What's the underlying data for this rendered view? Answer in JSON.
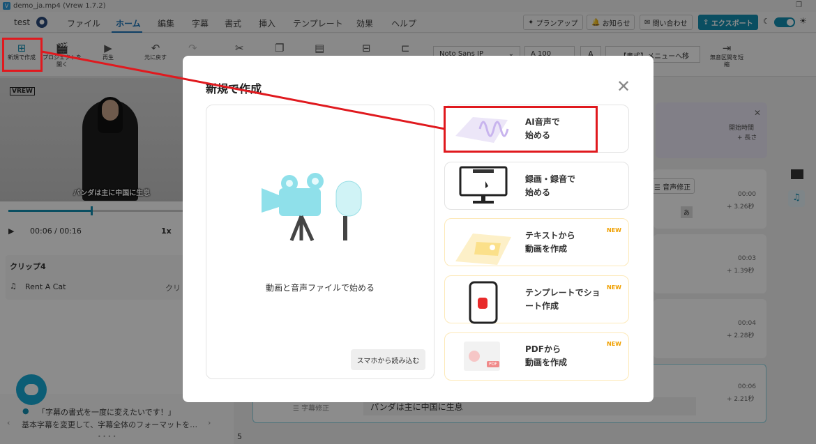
{
  "window": {
    "title": "demo_ja.mp4 (Vrew 1.7.2)",
    "app_icon": "V"
  },
  "menubar": {
    "user": "test",
    "items": [
      "ファイル",
      "ホーム",
      "編集",
      "字幕",
      "書式",
      "挿入",
      "テンプレート",
      "効果",
      "ヘルプ"
    ],
    "active": "ホーム",
    "plan_up": "プランアップ",
    "notice": "お知らせ",
    "contact": "問い合わせ",
    "export": "エクスポート"
  },
  "toolbar": {
    "new": "新規で作成",
    "open_project": "プロジェクトを開く",
    "play": "再生",
    "undo": "元に戻す",
    "font": "Noto Sans JP",
    "font_size": "100",
    "format_menu": "【書式】メニューへ移動",
    "shorten_silence": "無音区間を短縮"
  },
  "player": {
    "logo": "VREW",
    "subtitle": "パンダは主に中国に生息",
    "current_time": "00:06",
    "total_time": "/ 00:16",
    "speed": "1x",
    "progress": 0.45
  },
  "clip": {
    "title": "クリップ4",
    "music": "Rent A Cat",
    "music_action": "クリ"
  },
  "tip": {
    "title": "「字幕の書式を一度に変えたいです！」",
    "body": "基本字幕を変更して、字幕全体のフォーマットを…",
    "page_number": "5"
  },
  "right_panel": {
    "start_time_label": "開始時間",
    "length_label": "+ 長さ",
    "voice_fix": "音声修正",
    "rows": [
      {
        "time": "00:00",
        "length": "+ 3.26秒"
      },
      {
        "time": "00:03",
        "length": "+ 1.39秒"
      },
      {
        "time": "00:04",
        "length": "+ 2.28秒"
      },
      {
        "time": "00:06",
        "length": "+ 2.21秒"
      }
    ],
    "subtitle_fix_label": "字幕修正",
    "subtitle_text": "パンダは主に中国に生息",
    "kana": "あ"
  },
  "modal": {
    "title": "新規で作成",
    "main_option": "動画と音声ファイルで始める",
    "phone_import": "スマホから読み込む",
    "options": [
      {
        "line1": "AI音声で",
        "line2": "始める",
        "new": false
      },
      {
        "line1": "録画・録音で",
        "line2": "始める",
        "new": false
      },
      {
        "line1": "テキストから",
        "line2": "動画を作成",
        "new": true
      },
      {
        "line1": "テンプレートでショ",
        "line2": "ート作成",
        "new": true
      },
      {
        "line1": "PDFから",
        "line2": "動画を作成",
        "new": true
      }
    ],
    "new_badge": "NEW",
    "pdf_tag": "PDF"
  },
  "colors": {
    "accent": "#138fb1",
    "annotation": "#e0191e",
    "new_badge": "#f0a000"
  }
}
